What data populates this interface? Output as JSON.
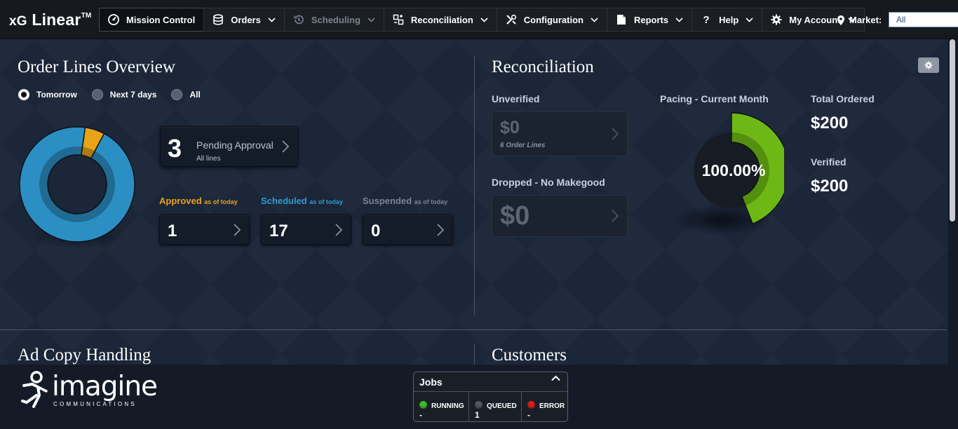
{
  "app": {
    "logo_prefix": "xG",
    "logo_main": "Linear",
    "logo_tm": "TM"
  },
  "nav": {
    "items": [
      {
        "label": "Mission Control",
        "icon": "dashboard-icon"
      },
      {
        "label": "Orders",
        "icon": "database-icon"
      },
      {
        "label": "Scheduling",
        "icon": "history-clock-icon"
      },
      {
        "label": "Reconciliation",
        "icon": "reconcile-icon"
      },
      {
        "label": "Configuration",
        "icon": "tools-icon"
      },
      {
        "label": "Reports",
        "icon": "document-icon"
      },
      {
        "label": "Help",
        "icon": "question-icon"
      },
      {
        "label": "My Account",
        "icon": "gear-icon"
      }
    ],
    "market_label": "Market:",
    "market_value": "All"
  },
  "order_lines": {
    "title": "Order Lines Overview",
    "filters": [
      "Tomorrow",
      "Next 7 days",
      "All"
    ],
    "selected_filter": "Tomorrow",
    "pending": {
      "count": "3",
      "label": "Pending Approval",
      "sub": "All lines"
    },
    "approved": {
      "label": "Approved",
      "suffix": "as of today",
      "value": "1",
      "color": "#e8a317"
    },
    "scheduled": {
      "label": "Scheduled",
      "suffix": "as of today",
      "value": "17",
      "color": "#2f9bd1"
    },
    "suspended": {
      "label": "Suspended",
      "suffix": "as of today",
      "value": "0",
      "color": "#7b8594"
    }
  },
  "chart_data": {
    "type": "pie",
    "categories": [
      "Approved",
      "Scheduled"
    ],
    "values": [
      1,
      17
    ],
    "colors": [
      "#e8a317",
      "#2b8fc4"
    ]
  },
  "reconciliation": {
    "title": "Reconciliation",
    "unverified": {
      "label": "Unverified",
      "value": "$0",
      "sub": "6 Order Lines"
    },
    "dropped": {
      "label": "Dropped - No Makegood",
      "value": "$0"
    },
    "pacing": {
      "label": "Pacing - Current Month",
      "percent_text": "100.00%",
      "percent": 100
    },
    "total_ordered": {
      "label": "Total Ordered",
      "value": "$200"
    },
    "verified": {
      "label": "Verified",
      "value": "$200"
    }
  },
  "lower": {
    "ad_copy_title": "Ad Copy Handling",
    "customers_title": "Customers"
  },
  "footer": {
    "brand": "imagine",
    "brand_sub": "COMMUNICATIONS",
    "jobs": {
      "title": "Jobs",
      "running": {
        "label": "RUNNING",
        "value": "-",
        "color": "#3fbf2a"
      },
      "queued": {
        "label": "QUEUED",
        "value": "1",
        "color": "#55595f"
      },
      "error": {
        "label": "ERROR",
        "value": "-",
        "color": "#d9211c"
      }
    }
  }
}
